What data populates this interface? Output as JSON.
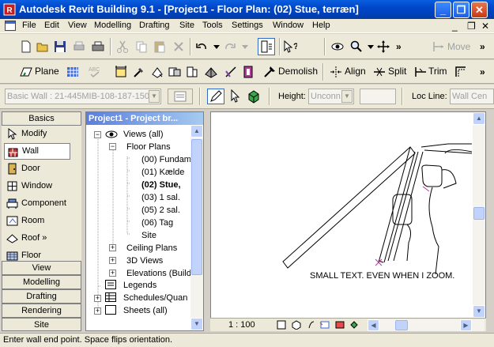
{
  "window": {
    "title": "Autodesk Revit Building 9.1 - [Project1 - Floor Plan: (02) Stue, terræn]",
    "minimize": "_",
    "restore": "❐",
    "close": "✕"
  },
  "menubar": {
    "items": [
      "File",
      "Edit",
      "View",
      "Modelling",
      "Drafting",
      "Site",
      "Tools",
      "Settings",
      "Window",
      "Help"
    ],
    "mdi": [
      "_",
      "❐",
      "✕"
    ]
  },
  "toolbar1": {
    "move_label": "Move",
    "more": "»"
  },
  "toolbar2": {
    "plane_label": "Plane",
    "demolish_label": "Demolish",
    "align_label": "Align",
    "split_label": "Split",
    "trim_label": "Trim"
  },
  "options_bar": {
    "type_value": "Basic Wall : 21-445MIB-108-187-150",
    "height_label": "Height:",
    "height_value": "Unconn",
    "loc_line_label": "Loc Line:",
    "loc_line_value": "Wall Cen"
  },
  "design_bar": {
    "tab_basics": "Basics",
    "items": [
      {
        "label": "Modify",
        "icon": "arrow-icon"
      },
      {
        "label": "Wall",
        "icon": "wall-icon"
      },
      {
        "label": "Door",
        "icon": "door-icon"
      },
      {
        "label": "Window",
        "icon": "window-icon"
      },
      {
        "label": "Component",
        "icon": "component-icon"
      },
      {
        "label": "Room",
        "icon": "room-icon"
      },
      {
        "label": "Roof »",
        "icon": "roof-icon"
      },
      {
        "label": "Floor",
        "icon": "floor-icon"
      }
    ],
    "bottom_tabs": [
      "View",
      "Modelling",
      "Drafting",
      "Rendering",
      "Site"
    ]
  },
  "project_browser": {
    "title": "Project1 - Project br...",
    "nodes": {
      "views": "Views (all)",
      "floor_plans": "Floor Plans",
      "fp": [
        "(00) Fundam",
        "(01) Kælde",
        "(02) Stue,",
        "(03) 1 sal.",
        "(05) 2 sal.",
        "(06) Tag",
        "Site"
      ],
      "ceiling_plans": "Ceiling Plans",
      "views_3d": "3D Views",
      "elevations": "Elevations (Build",
      "legends": "Legends",
      "schedules": "Schedules/Quan",
      "sheets": "Sheets (all)"
    }
  },
  "canvas": {
    "annotation": "SMALL TEXT. EVEN WHEN I ZOOM."
  },
  "view_control": {
    "scale": "1 : 100"
  },
  "status_bar": {
    "message": "Enter wall end point.  Space flips orientation."
  }
}
